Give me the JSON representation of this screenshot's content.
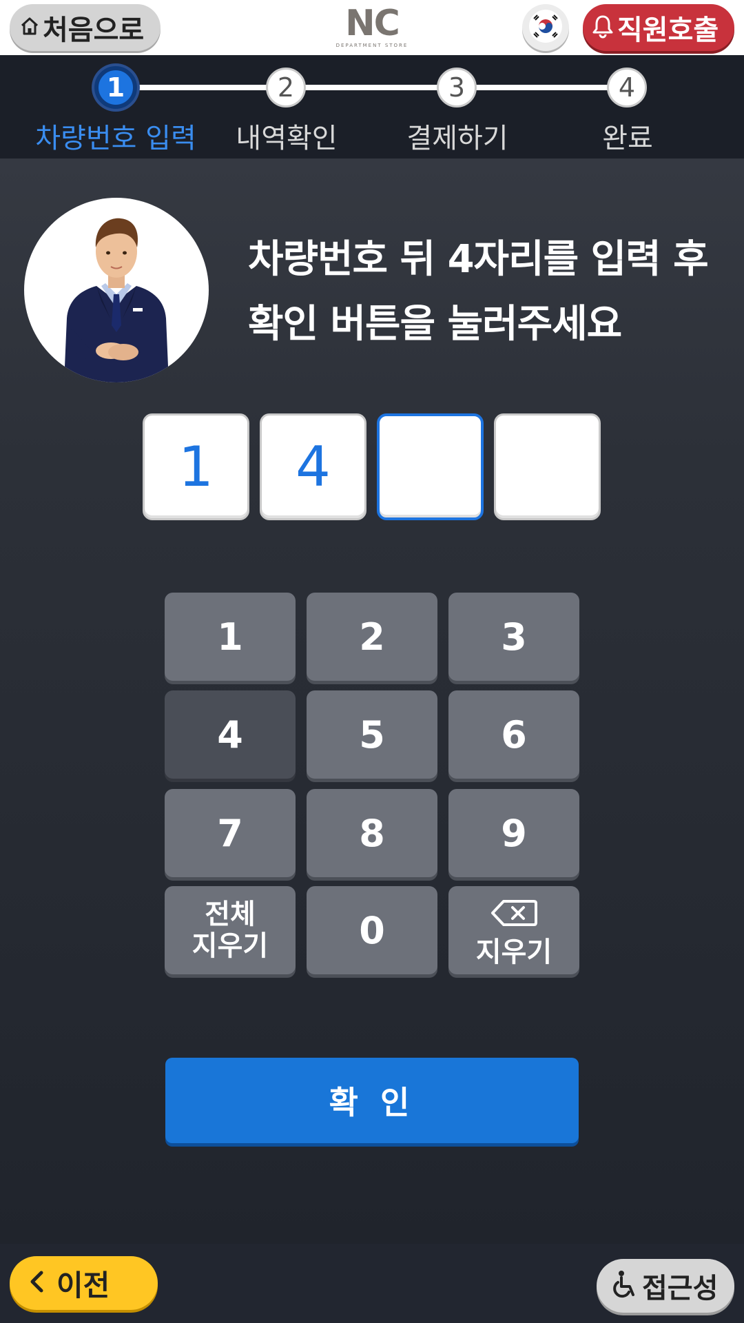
{
  "header": {
    "home_label": "처음으로",
    "logo_text": "NC",
    "logo_sub": "DEPARTMENT STORE",
    "call_label": "직원호출"
  },
  "stepper": {
    "steps": [
      {
        "number": "1",
        "label": "차량번호 입력",
        "active": true
      },
      {
        "number": "2",
        "label": "내역확인",
        "active": false
      },
      {
        "number": "3",
        "label": "결제하기",
        "active": false
      },
      {
        "number": "4",
        "label": "완료",
        "active": false
      }
    ]
  },
  "instruction": {
    "line1": "차량번호 뒤 4자리를 입력 후",
    "line2": "확인 버튼을 눌러주세요"
  },
  "digits": [
    "1",
    "4",
    "",
    ""
  ],
  "keypad": {
    "k1": "1",
    "k2": "2",
    "k3": "3",
    "k4": "4",
    "k5": "5",
    "k6": "6",
    "k7": "7",
    "k8": "8",
    "k9": "9",
    "clear_all_line1": "전체",
    "clear_all_line2": "지우기",
    "k0": "0",
    "backspace_label": "지우기"
  },
  "confirm_label": "확 인",
  "footer": {
    "prev_label": "이전",
    "accessibility_label": "접근성"
  },
  "colors": {
    "accent": "#1976d8",
    "call": "#c8323c",
    "prev": "#ffc623",
    "key": "#6d717a"
  },
  "icons": [
    "home-icon",
    "korea-flag-icon",
    "bell-icon",
    "backspace-icon",
    "chevron-left-icon",
    "wheelchair-icon"
  ]
}
